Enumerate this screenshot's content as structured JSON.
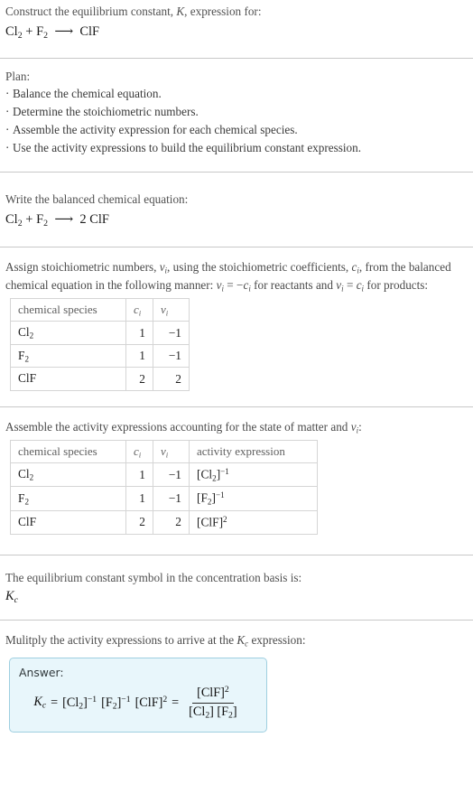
{
  "header": {
    "prompt_pre": "Construct the equilibrium constant, ",
    "prompt_symbol": "K",
    "prompt_post": ", expression for:",
    "equation": {
      "reactant1": "Cl",
      "reactant1_sub": "2",
      "plus": "+",
      "reactant2": "F",
      "reactant2_sub": "2",
      "arrow": "⟶",
      "product": "ClF"
    }
  },
  "plan": {
    "label": "Plan:",
    "bullet_glyph": "·",
    "items": [
      "Balance the chemical equation.",
      "Determine the stoichiometric numbers.",
      "Assemble the activity expression for each chemical species.",
      "Use the activity expressions to build the equilibrium constant expression."
    ]
  },
  "balanced": {
    "label": "Write the balanced chemical equation:",
    "equation": {
      "reactant1": "Cl",
      "reactant1_sub": "2",
      "plus": "+",
      "reactant2": "F",
      "reactant2_sub": "2",
      "arrow": "⟶",
      "coefficient": "2",
      "product": "ClF"
    }
  },
  "assign": {
    "text_1": "Assign stoichiometric numbers, ",
    "nu_1": "ν",
    "sub_i_1": "i",
    "text_2": ", using the stoichiometric coefficients, ",
    "c_1": "c",
    "sub_i_2": "i",
    "text_3": ", from the balanced chemical equation in the following manner: ",
    "nu_2": "ν",
    "sub_i_3": "i",
    "equals_1": " = −",
    "c_2": "c",
    "sub_i_4": "i",
    "text_4": " for reactants and ",
    "nu_3": "ν",
    "sub_i_5": "i",
    "equals_2": " = ",
    "c_3": "c",
    "sub_i_6": "i",
    "text_5": " for products:"
  },
  "table_stoich": {
    "headers": {
      "species": "chemical species",
      "c": "c",
      "c_sub": "i",
      "nu": "ν",
      "nu_sub": "i"
    },
    "rows": [
      {
        "species": "Cl",
        "species_sub": "2",
        "c": "1",
        "nu": "−1"
      },
      {
        "species": "F",
        "species_sub": "2",
        "c": "1",
        "nu": "−1"
      },
      {
        "species": "ClF",
        "species_sub": "",
        "c": "2",
        "nu": "2"
      }
    ]
  },
  "assemble": {
    "text_1": "Assemble the activity expressions accounting for the state of matter and ",
    "nu": "ν",
    "sub_i": "i",
    "text_2": ":"
  },
  "table_activity": {
    "headers": {
      "species": "chemical species",
      "c": "c",
      "c_sub": "i",
      "nu": "ν",
      "nu_sub": "i",
      "activity": "activity expression"
    },
    "rows": [
      {
        "species": "Cl",
        "species_sub": "2",
        "c": "1",
        "nu": "−1",
        "act_open": "[Cl",
        "act_sub": "2",
        "act_close": "]",
        "act_exp": "−1"
      },
      {
        "species": "F",
        "species_sub": "2",
        "c": "1",
        "nu": "−1",
        "act_open": "[F",
        "act_sub": "2",
        "act_close": "]",
        "act_exp": "−1"
      },
      {
        "species": "ClF",
        "species_sub": "",
        "c": "2",
        "nu": "2",
        "act_open": "[ClF",
        "act_sub": "",
        "act_close": "]",
        "act_exp": "2"
      }
    ]
  },
  "kc_symbol": {
    "label": "The equilibrium constant symbol in the concentration basis is:",
    "symbol": "K",
    "symbol_sub": "c"
  },
  "multiply": {
    "text_1": "Mulitply the activity expressions to arrive at the ",
    "symbol": "K",
    "symbol_sub": "c",
    "text_2": " expression:"
  },
  "answer": {
    "label": "Answer:",
    "kc": "K",
    "kc_sub": "c",
    "equals_1": "=",
    "term1_open": "[Cl",
    "term1_sub": "2",
    "term1_close": "]",
    "term1_exp": "−1",
    "term2_open": "[F",
    "term2_sub": "2",
    "term2_close": "]",
    "term2_exp": "−1",
    "term3_open": "[ClF",
    "term3_close": "]",
    "term3_exp": "2",
    "equals_2": "=",
    "numerator_open": "[ClF",
    "numerator_close": "]",
    "numerator_exp": "2",
    "denom1_open": "[Cl",
    "denom1_sub": "2",
    "denom1_close": "]",
    "denom2_open": "[F",
    "denom2_sub": "2",
    "denom2_close": "]"
  },
  "colors": {
    "answer_bg": "#e8f6fb",
    "answer_border": "#9ecfe0",
    "rule": "#c8c8c8",
    "text": "#2b2b2b"
  }
}
